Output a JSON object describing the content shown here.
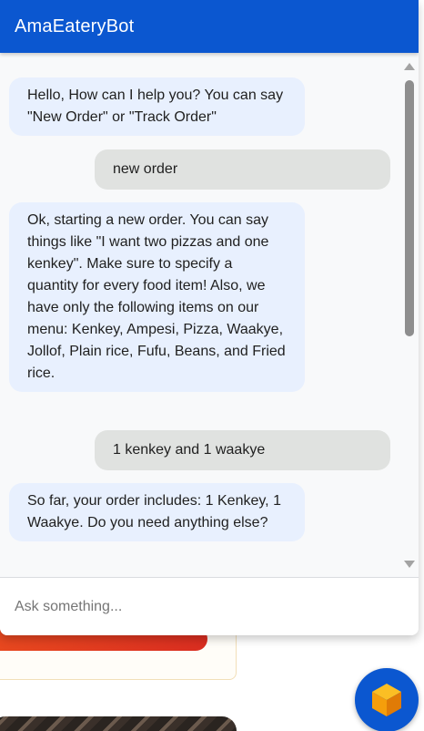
{
  "chat": {
    "title": "AmaEateryBot",
    "messages": [
      {
        "sender": "bot",
        "text": "Hello, How can I help you? You can say \"New Order\" or \"Track Order\""
      },
      {
        "sender": "user",
        "text": "new order"
      },
      {
        "sender": "bot",
        "text": "Ok, starting a new order. You can say things like \"I want two pizzas and one kenkey\". Make sure to specify a quantity for every food item! Also, we have only the following items on our menu: Kenkey, Ampesi, Pizza, Waakye, Jollof, Plain rice, Fufu, Beans, and Fried rice."
      },
      {
        "sender": "user",
        "text": "1 kenkey and 1 waakye"
      },
      {
        "sender": "bot",
        "text": "So far, your order includes: 1 Kenkey, 1 Waakye. Do you need anything else?"
      }
    ],
    "input": {
      "placeholder": "Ask something...",
      "value": ""
    }
  },
  "launcher": {
    "icon": "cube-icon"
  },
  "colors": {
    "header": "#0b57d0",
    "bot_bubble": "#e8f0fe",
    "user_bubble": "#e0e2e0",
    "launcher_cube": "#f59e0b"
  }
}
